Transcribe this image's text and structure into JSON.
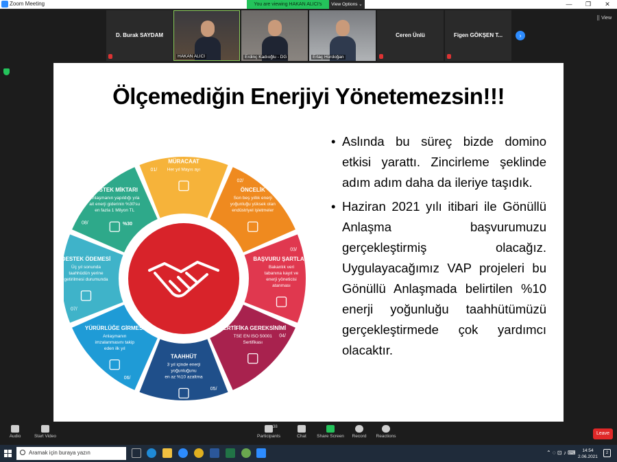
{
  "window": {
    "title": "Zoom Meeting",
    "controls": [
      "—",
      "❐",
      "✕"
    ]
  },
  "share_banner": {
    "text": "You are viewing HAKAN ALICI's screen",
    "view_options": "View Options ⌄"
  },
  "view_button": "View",
  "participants_strip": [
    {
      "name": "D. Burak SAYDAM",
      "video": false
    },
    {
      "name": "HAKAN ALICI",
      "video": true
    },
    {
      "name": "Erdinç Kadıoğlu - DG",
      "video": true
    },
    {
      "name": "Ertaç Hürdoğan",
      "video": true
    },
    {
      "name": "Ceren Ünlü",
      "video": false
    },
    {
      "name": "Figen GÖKŞEN T...",
      "video": false
    }
  ],
  "slide": {
    "title": "Ölçemediğin Enerjiyi Yönetemezsin!!!",
    "bullets": [
      "Aslında bu süreç bizde domino etkisi yarattı. Zincirleme şeklinde adım adım daha da ileriye taşıdık.",
      "Haziran 2021 yılı itibari ile Gönüllü Anlaşma başvurumuzu gerçekleştirmiş olacağız. Uygulayacağımız VAP projeleri bu Gönüllü Anlaşmada belirtilen %10 enerji yoğunluğu taahhütümüzü gerçekleştirmede çok yardımcı olacaktır."
    ],
    "wheel": [
      {
        "num": "01/",
        "title": "MÜRACAAT",
        "text": [
          "Her yıl Mayıs ayı"
        ],
        "color": "#f6b33a"
      },
      {
        "num": "02/",
        "title": "ÖNCELİK",
        "text": [
          "Son beş yıllık enerji",
          "yoğunluğu yüksek olan",
          "endüstriyel işletmeler"
        ],
        "color": "#ef8a1f"
      },
      {
        "num": "03/",
        "title": "BAŞVURU ŞARTLARI",
        "text": [
          "Bakanlık veri",
          "tabanına kayıt ve",
          "enerji yöneticisi",
          "atanması"
        ],
        "color": "#e0384f"
      },
      {
        "num": "04/",
        "title": "SERTİFİKA GEREKSİNİMİ",
        "text": [
          "TSE EN ISO 50001",
          "Sertifikası"
        ],
        "color": "#a8224e"
      },
      {
        "num": "05/",
        "title": "TAAHHÜT",
        "text": [
          "3 yıl içinde enerji",
          "yoğunluğunu",
          "en az %10 azaltma"
        ],
        "color": "#1f4f8a"
      },
      {
        "num": "06/",
        "title": "YÜRÜRLÜĞE GİRMESİ",
        "text": [
          "Anlaşmanın",
          "imzalanmasını takip",
          "eden ilk yıl"
        ],
        "color": "#1f9bd6"
      },
      {
        "num": "07/",
        "title": "DESTEK ÖDEMESİ",
        "text": [
          "Üç yıl sonunda",
          "taahhüdün yerine",
          "getirilmesi durumunda"
        ],
        "color": "#3fb3c9"
      },
      {
        "num": "08/",
        "title": "DESTEK MİKTARI",
        "text": [
          "Anlaşmanın yapıldığı yıla",
          "ait enerji giderinin %30'su",
          "en fazla 1 Milyon TL"
        ],
        "color": "#2ea98a"
      }
    ],
    "badge_30": "%30"
  },
  "toolbar": {
    "audio": "Audio",
    "start_video": "Start Video",
    "participants": "Participants",
    "participants_count": "38",
    "chat": "Chat",
    "share_screen": "Share Screen",
    "record": "Record",
    "reactions": "Reactions",
    "leave": "Leave"
  },
  "taskbar": {
    "search_placeholder": "Aramak için buraya yazın",
    "time": "14:54",
    "date": "2.06.2021",
    "notifications": "2"
  }
}
